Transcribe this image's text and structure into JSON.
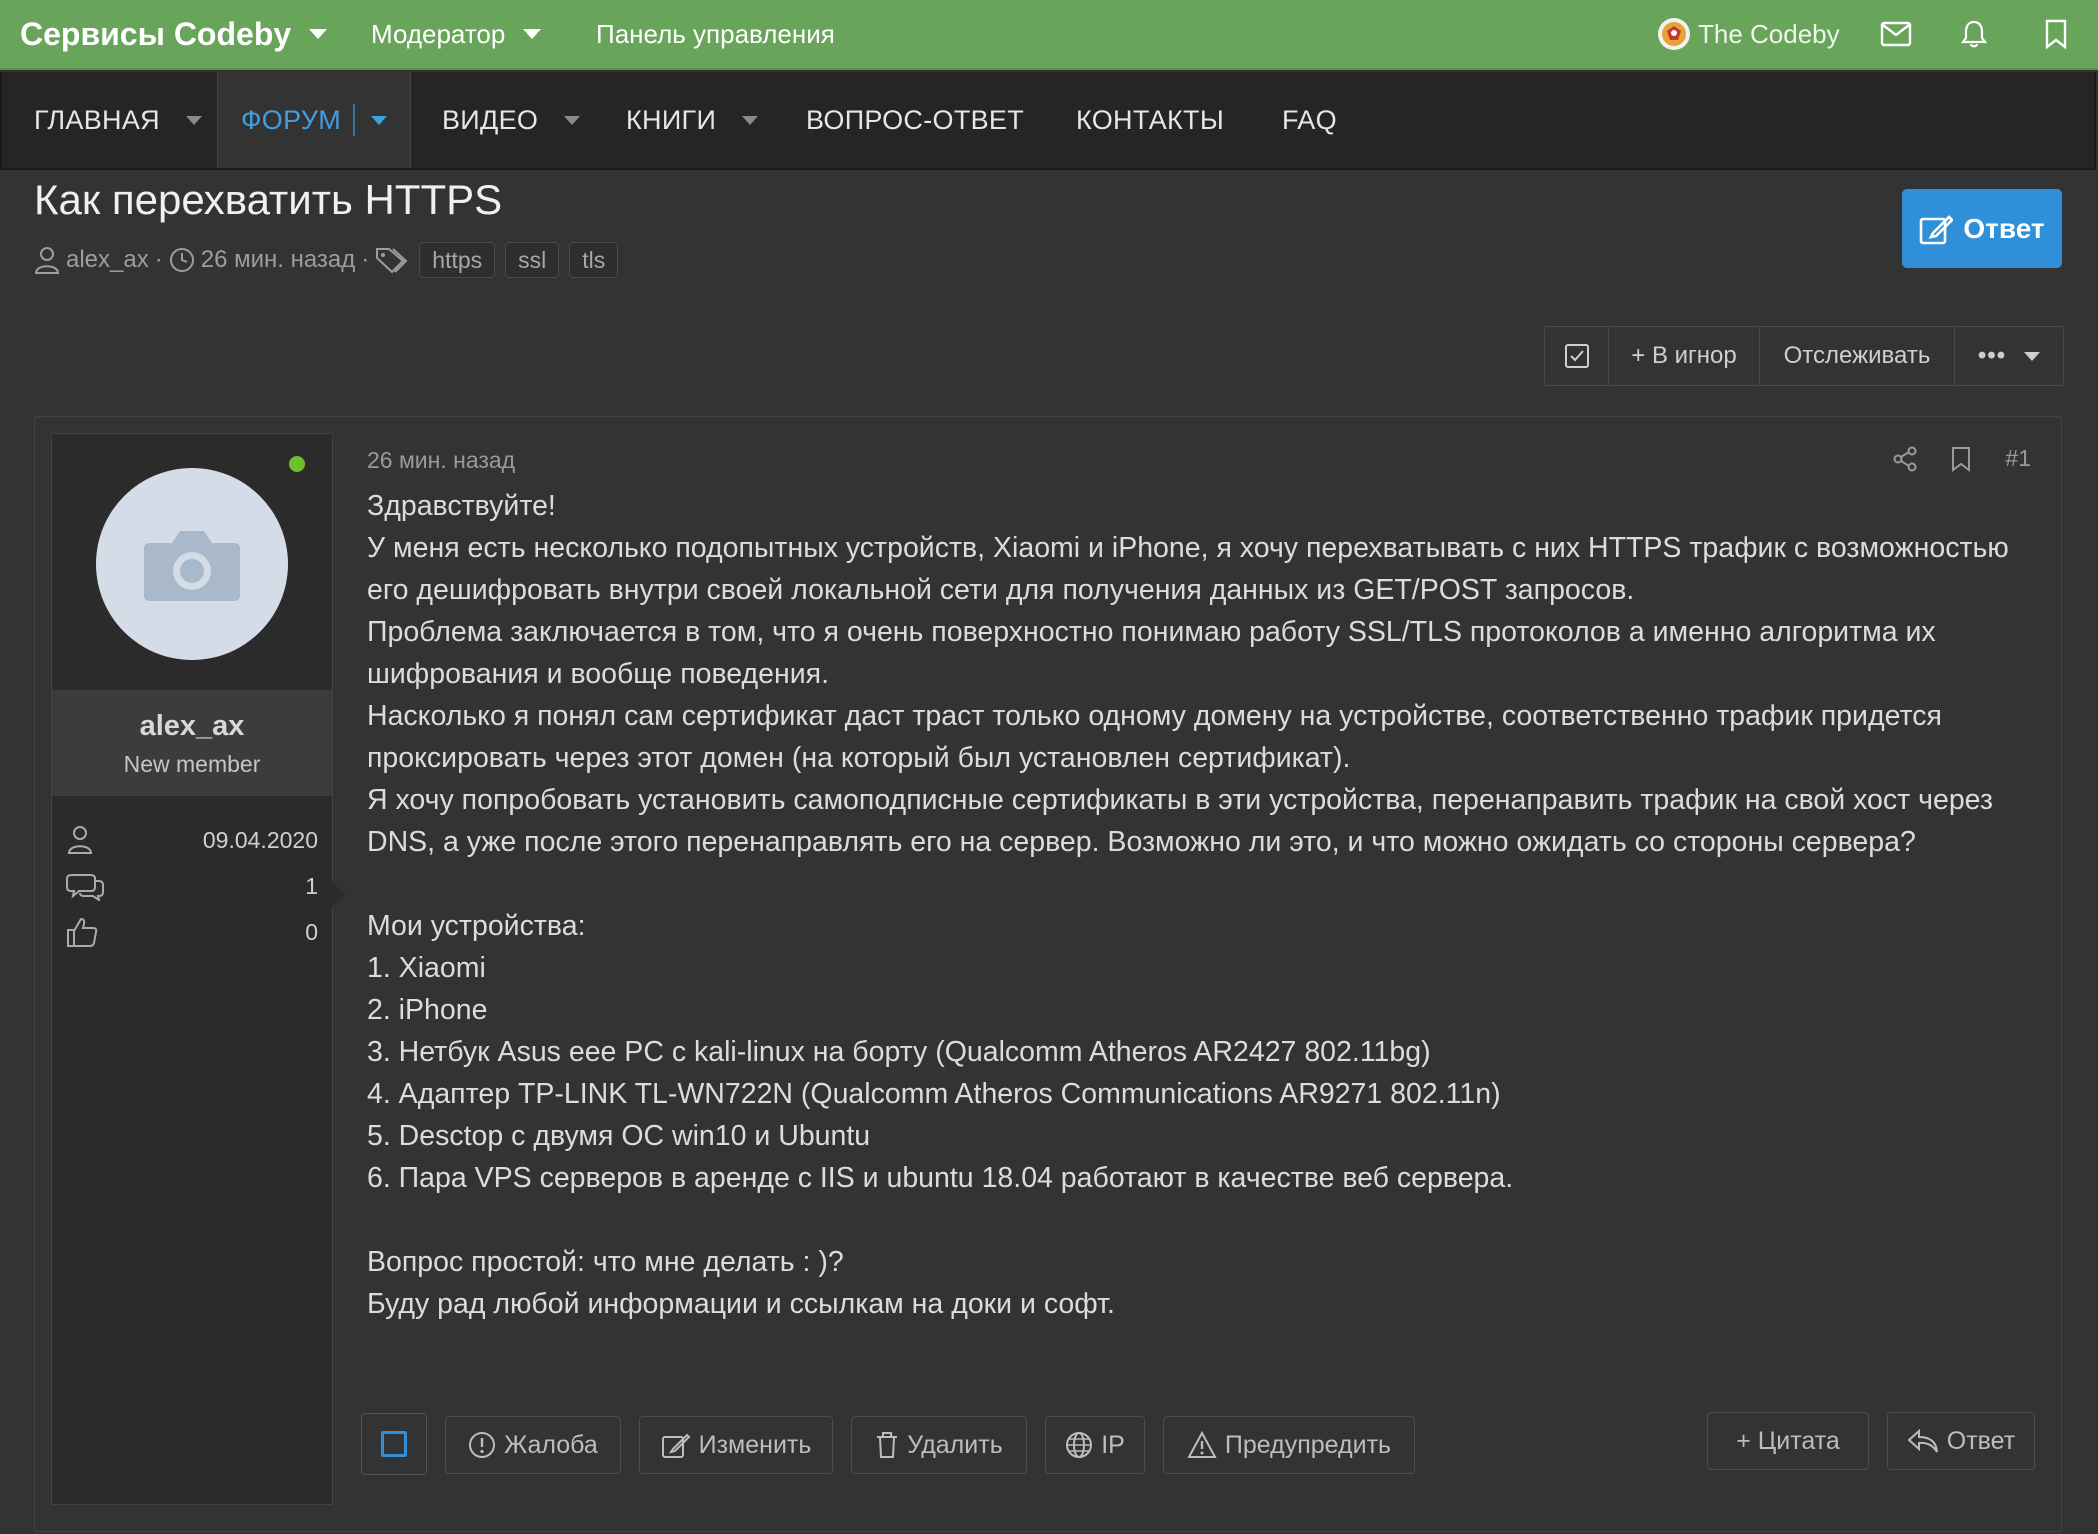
{
  "colors": {
    "topbar": "#68a45a",
    "accent": "#2f8fd8",
    "nav_active": "#3f9fe0",
    "online": "#6ec02a",
    "background": "#333333"
  },
  "topbar": {
    "brand": "Сервисы Codeby",
    "moderator": "Модератор",
    "control_panel": "Панель управления",
    "user": "The Codeby",
    "icons": [
      "envelope-icon",
      "bell-icon",
      "bookmark-icon"
    ]
  },
  "nav": {
    "items": [
      {
        "label": "ГЛАВНАЯ",
        "dropdown": true
      },
      {
        "label": "ФОРУМ",
        "dropdown": true,
        "active": true
      },
      {
        "label": "ВИДЕО",
        "dropdown": true
      },
      {
        "label": "КНИГИ",
        "dropdown": true
      },
      {
        "label": "ВОПРОС-ОТВЕТ",
        "dropdown": false
      },
      {
        "label": "КОНТАКТЫ",
        "dropdown": false
      },
      {
        "label": "FAQ",
        "dropdown": false
      }
    ]
  },
  "thread": {
    "title": "Как перехватить HTTPS",
    "author": "alex_ax",
    "time": "26 мин. назад",
    "tags": [
      "https",
      "ssl",
      "tls"
    ],
    "reply_button": "Ответ"
  },
  "actions": {
    "ignore": "+ В игнор",
    "watch": "Отслеживать",
    "more": "•••"
  },
  "post": {
    "user": {
      "name": "alex_ax",
      "role": "New member",
      "joined": "09.04.2020",
      "messages": "1",
      "reactions": "0"
    },
    "time": "26 мин. назад",
    "number": "#1",
    "body": [
      "Здравствуйте!",
      "У меня есть несколько подопытных устройств, Xiaomi и iPhone, я хочу перехватывать с них HTTPS трафик с возможностью его дешифровать внутри своей локальной сети для получения данных из GET/POST запросов.",
      "Проблема заключается в том, что я очень поверхностно понимаю работу SSL/TLS протоколов а именно алгоритма их шифрования и вообще поведения.",
      "Насколько я понял сам сертификат даст траст только одному домену на устройстве, соответственно трафик придется проксировать через этот домен (на который был установлен сертификат).",
      "Я хочу попробовать установить самоподписные сертификаты в эти устройства, перенаправить трафик на свой хост через DNS, а уже после этого перенаправлять его на сервер. Возможно ли это, и что можно ожидать со стороны сервера?",
      "",
      "Мои устройства:",
      "1. Xiaomi",
      "2. iPhone",
      "3. Нетбук Asus eee PC с kali-linux на борту (Qualcomm Atheros AR2427 802.11bg)",
      "4. Адаптер TP-LINK TL-WN722N (Qualcomm Atheros Communications AR9271 802.11n)",
      "5. Desctop с двумя ОС win10 и Ubuntu",
      "6. Пара VPS серверов в аренде с IIS и ubuntu 18.04 работают в качестве веб сервера.",
      "",
      "Вопрос простой: что мне делать : )?",
      "Буду рад любой информации и ссылкам на доки и софт."
    ],
    "footer": {
      "report": "Жалоба",
      "edit": "Изменить",
      "delete": "Удалить",
      "ip": "IP",
      "warn": "Предупредить",
      "quote": "+ Цитата",
      "reply": "Ответ"
    }
  }
}
